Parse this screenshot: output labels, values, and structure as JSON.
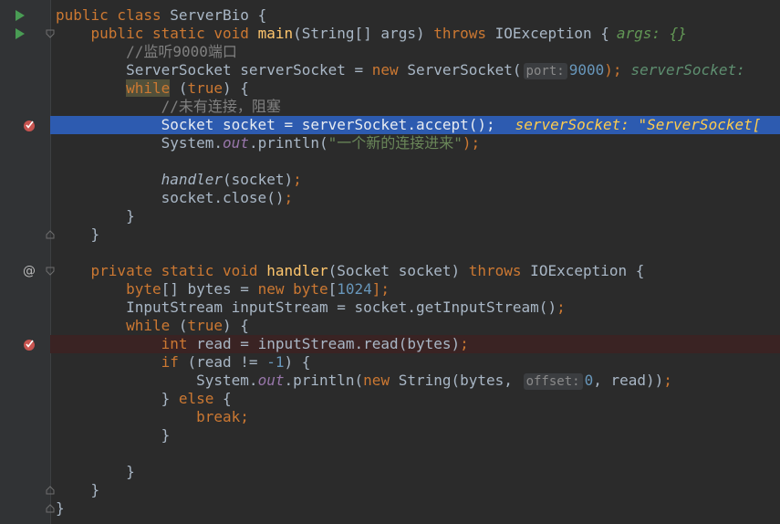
{
  "editor": {
    "file_class": "ServerBio",
    "lines": {
      "l1": {
        "kw1": "public class ",
        "cls": "ServerBio {"
      },
      "l2": {
        "kw": "public static void ",
        "fn": "main",
        "p1": "(String[] args) ",
        "kw2": "throws",
        "p2": " IOException {",
        "inline": "args: {}"
      },
      "l3": {
        "cmt": "//监听9000端口"
      },
      "l4": {
        "a": "ServerSocket serverSocket = ",
        "kw": "new",
        "b": " ServerSocket(",
        "hint": "port:",
        "num": "9000",
        "c": ");",
        "inline": "serverSocket:"
      },
      "l5": {
        "kw": "while",
        "a": " (",
        "kw2": "true",
        "b": ") {"
      },
      "l6": {
        "cmt": "//未有连接，阻塞"
      },
      "l7": {
        "a": "Socket socket = serverSocket.accept();",
        "inline": "serverSocket: \"ServerSocket["
      },
      "l8": {
        "a": "System.",
        "fld": "out",
        "b": ".println(",
        "str": "\"一个新的连接进来\"",
        "c": ");"
      },
      "l10": {
        "it": "handler",
        "a": "(socket)",
        "c": ";"
      },
      "l11": {
        "a": "socket.close()",
        "c": ";"
      },
      "l12": {
        "a": "}"
      },
      "l13": {
        "a": "}"
      },
      "l15": {
        "kw": "private static void ",
        "fn": "handler",
        "p1": "(Socket socket) ",
        "kw2": "throws",
        "p2": " IOException {"
      },
      "l16": {
        "kw": "byte",
        "a": "[] bytes = ",
        "kw2": "new byte",
        "b": "[",
        "num": "1024",
        "c": "];"
      },
      "l17": {
        "a": "InputStream inputStream = socket.getInputStream()",
        "c": ";"
      },
      "l18": {
        "kw": "while",
        "a": " (",
        "kw2": "true",
        "b": ") {"
      },
      "l19": {
        "kw": "int",
        "a": " read = inputStream.read(bytes)",
        "c": ";"
      },
      "l20": {
        "kw": "if",
        "a": " (read != ",
        "num": "-1",
        "b": ") {"
      },
      "l21": {
        "a": "System.",
        "fld": "out",
        "b": ".println(",
        "kw": "new",
        "c": " String(bytes, ",
        "hint": "offset:",
        "num": "0",
        "d": ", read))",
        "e": ";"
      },
      "l22": {
        "a": "} ",
        "kw": "else",
        "b": " {"
      },
      "l23": {
        "kw": "break",
        "c": ";"
      },
      "l24": {
        "a": "}"
      },
      "l26": {
        "a": "}"
      },
      "l27": {
        "a": "}"
      },
      "l28": {
        "a": "}"
      }
    }
  },
  "colors": {
    "background": "#2b2b2b",
    "gutter": "#313335",
    "execution_line": "#2d5bb0",
    "breakpoint_line": "#3a2323",
    "keyword": "#cc7832",
    "function": "#ffc66d",
    "string": "#6a8759",
    "number": "#6897bb"
  },
  "gutter_icons": [
    "run-icon",
    "breakpoint-icon",
    "fold-icon",
    "override-icon"
  ],
  "gutter": {
    "at_symbol": "@"
  }
}
